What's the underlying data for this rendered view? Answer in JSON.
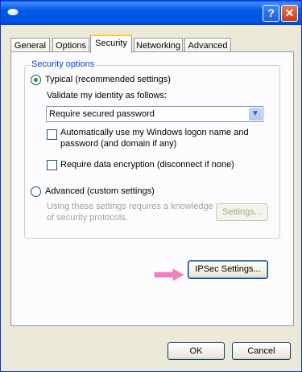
{
  "window": {
    "help_label": "?",
    "close_label": "✕",
    "icon": "network-icon"
  },
  "tabs": [
    {
      "label": "General",
      "active": false
    },
    {
      "label": "Options",
      "active": false
    },
    {
      "label": "Security",
      "active": true
    },
    {
      "label": "Networking",
      "active": false
    },
    {
      "label": "Advanced",
      "active": false
    }
  ],
  "security": {
    "group_label": "Security options",
    "typical_label": "Typical (recommended settings)",
    "validate_label": "Validate my identity as follows:",
    "identity_select": {
      "value": "Require secured password"
    },
    "auto_logon_label_line1": "Automatically use my Windows logon name and",
    "auto_logon_label_line2": "password (and domain if any)",
    "encryption_label": "Require data encryption (disconnect if none)",
    "advanced_label": "Advanced (custom settings)",
    "advanced_hint_line1": "Using these settings requires a knowledge",
    "advanced_hint_line2": "of security protocols.",
    "settings_label": "Settings...",
    "ipsec_label": "IPSec Settings..."
  },
  "footer": {
    "ok_label": "OK",
    "cancel_label": "Cancel"
  },
  "colors": {
    "titlebar": "#0054e3",
    "dialog": "#ece9d8",
    "panel": "#fcfcfe",
    "group_label": "#0046d5",
    "radio_dot": "#21a121",
    "arrow": "#f080c0"
  }
}
